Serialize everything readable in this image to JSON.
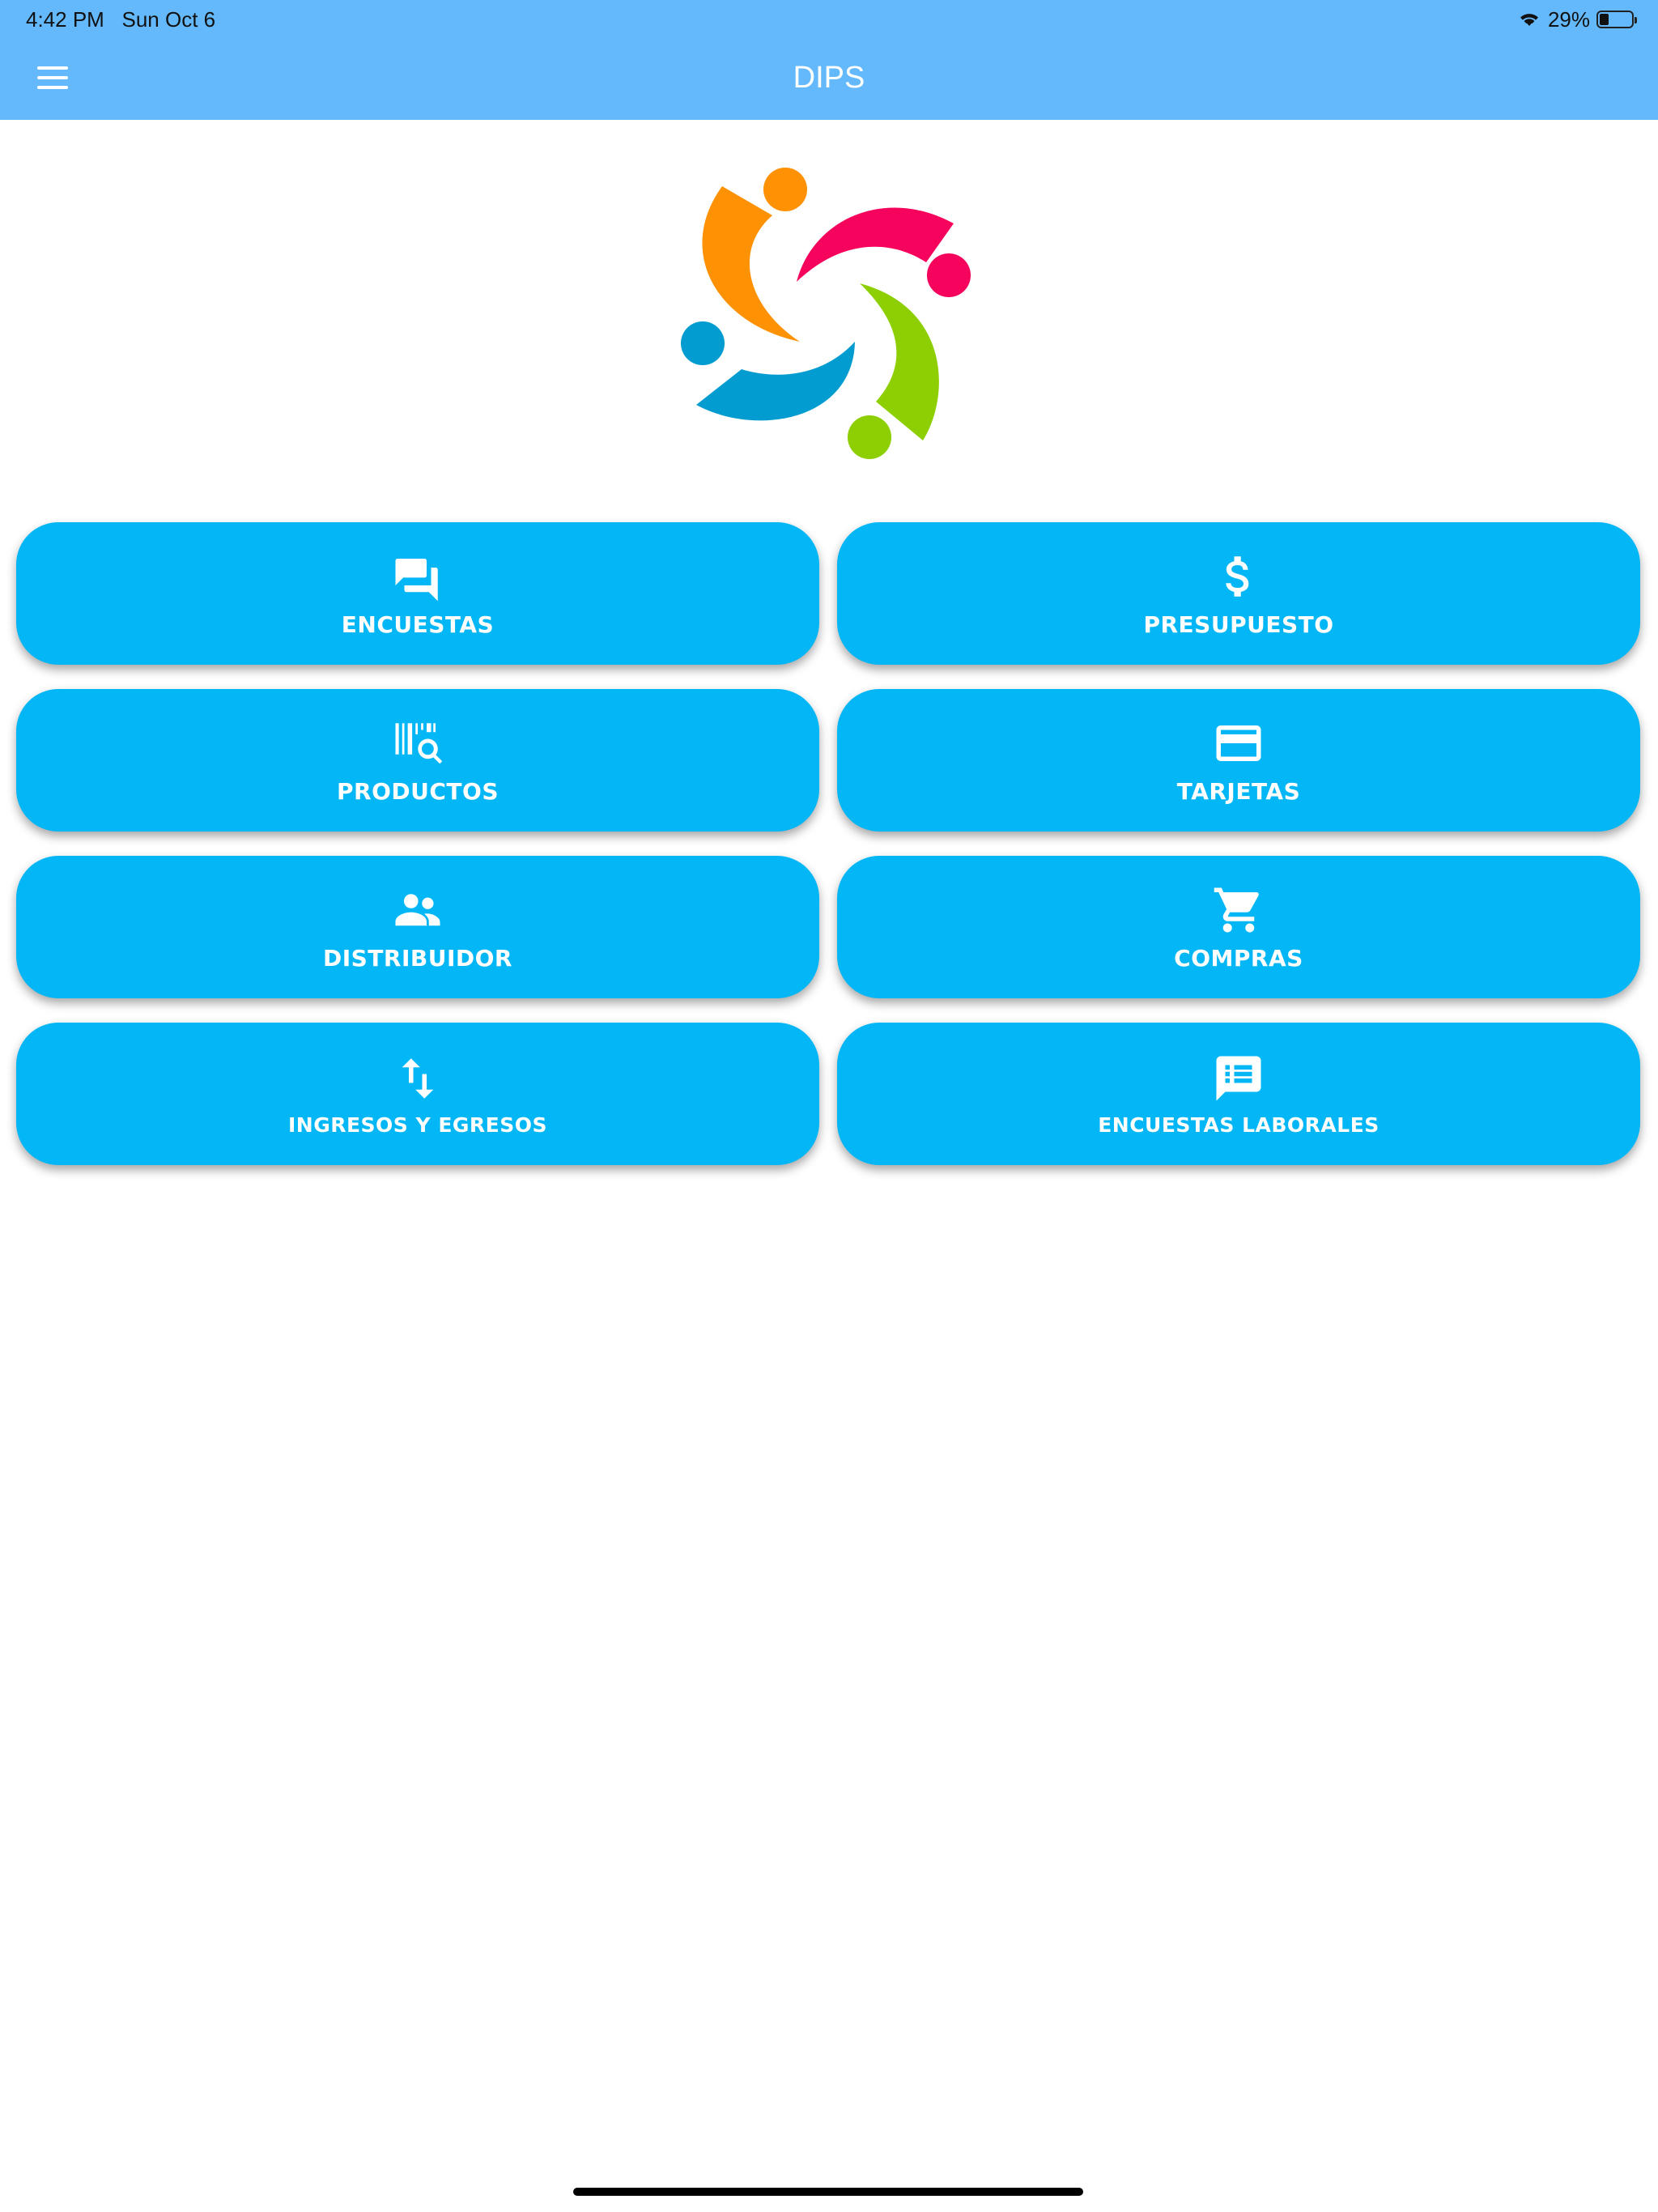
{
  "status_bar": {
    "time": "4:42 PM   Sun Oct 6",
    "battery": "29%",
    "battery_level": 0.29,
    "wifi_icon": "wifi-icon"
  },
  "app_bar": {
    "title": "DIPS",
    "menu_icon": "hamburger-menu-icon"
  },
  "colors": {
    "app_bar": "#64B9FC",
    "tile": "#03B7F6",
    "logo_orange": "#FF9105",
    "logo_pink": "#F5035D",
    "logo_blue": "#039CD0",
    "logo_green": "#8DCF03"
  },
  "tiles": [
    {
      "label": "ENCUESTAS",
      "icon": "chat-bubbles-icon"
    },
    {
      "label": "PRESUPUESTO",
      "icon": "dollar-icon"
    },
    {
      "label": "PRODUCTOS",
      "icon": "barcode-search-icon"
    },
    {
      "label": "TARJETAS",
      "icon": "credit-card-icon"
    },
    {
      "label": "DISTRIBUIDOR",
      "icon": "people-icon"
    },
    {
      "label": "COMPRAS",
      "icon": "shopping-cart-icon"
    },
    {
      "label": "INGRESOS Y EGRESOS",
      "icon": "swap-vertical-icon"
    },
    {
      "label": "ENCUESTAS LABORALES",
      "icon": "list-message-icon"
    }
  ]
}
